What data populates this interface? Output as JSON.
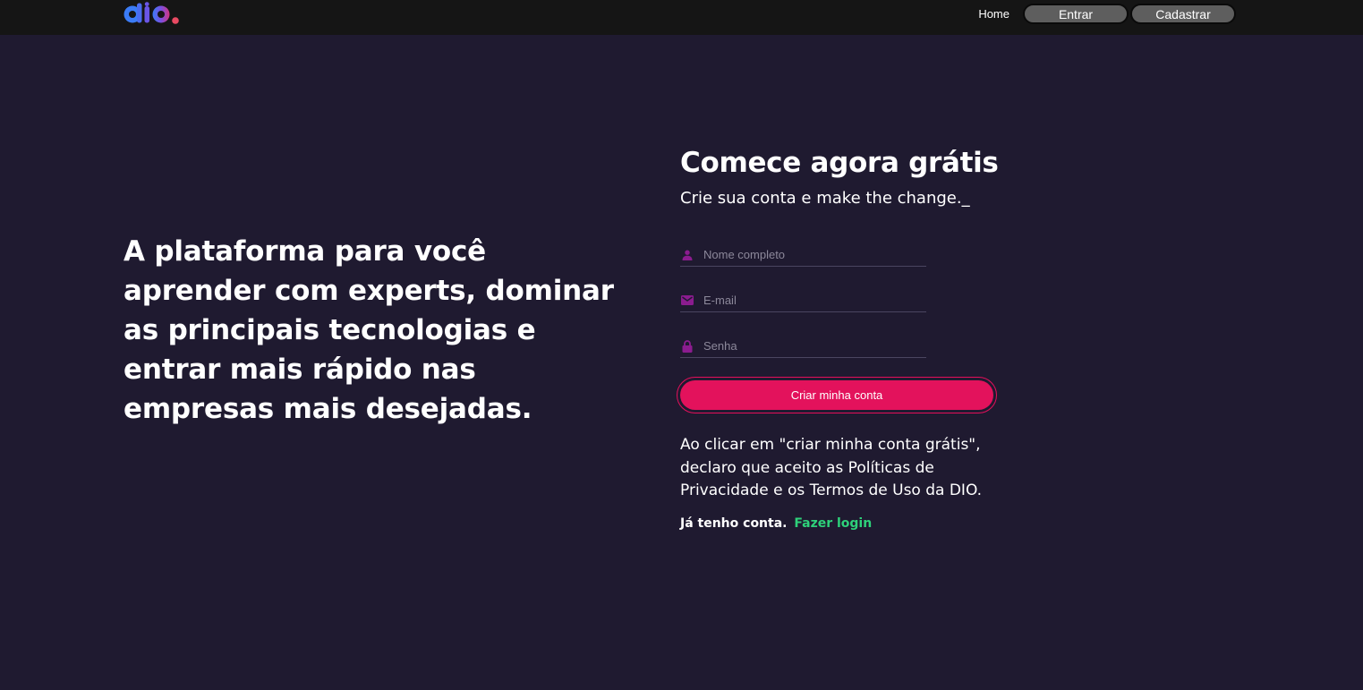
{
  "header": {
    "logo_alt": "dio.",
    "nav": {
      "home": "Home",
      "login": "Entrar",
      "signup": "Cadastrar"
    }
  },
  "hero": {
    "headline": "A plataforma para você aprender com experts, dominar as principais tecnologias e entrar mais rápido nas empresas mais desejadas."
  },
  "signup_form": {
    "title": "Comece agora grátis",
    "subtitle": "Crie sua conta e make the change._",
    "fields": {
      "name_placeholder": "Nome completo",
      "email_placeholder": "E-mail",
      "password_placeholder": "Senha"
    },
    "submit_label": "Criar minha conta",
    "legal_text": "Ao clicar em \"criar minha conta grátis\", declaro que aceito as Políticas de Privacidade e os Termos de Uso da DIO.",
    "have_account": "Já tenho conta.",
    "login_link": "Fazer login"
  },
  "colors": {
    "background": "#1f1a30",
    "topbar": "#151515",
    "accent": "#e3125c",
    "link_green": "#2ed17a",
    "icon_purple": "#8b1c8f"
  },
  "icons": {
    "name_field": "person-icon",
    "email_field": "mail-icon",
    "password_field": "lock-icon"
  }
}
